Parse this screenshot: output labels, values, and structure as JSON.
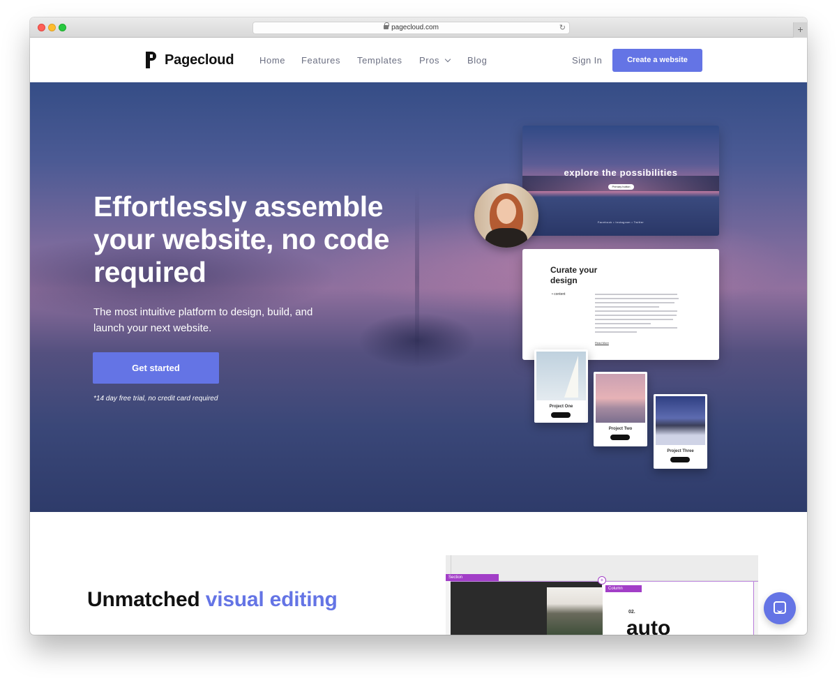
{
  "browser": {
    "url": "pagecloud.com",
    "new_tab_label": "+"
  },
  "nav": {
    "logo_text": "Pagecloud",
    "links": [
      "Home",
      "Features",
      "Templates",
      "Pros",
      "Blog"
    ],
    "sign_in": "Sign In",
    "cta": "Create a website"
  },
  "hero": {
    "title": "Effortlessly assemble your website, no code required",
    "subtitle": "The most intuitive platform to design, build, and launch your next website.",
    "button": "Get started",
    "note": "*14 day free trial, no credit card required"
  },
  "mockup": {
    "explore_title": "explore the possibilities",
    "explore_button": "Primary button",
    "explore_links": "Facebook  •  Instagram  •  Twitter",
    "curate_title": "Curate your design",
    "curate_bullet": "• content",
    "curate_more": "Read More",
    "projects": [
      "Project One",
      "Project Two",
      "Project Three"
    ]
  },
  "section2": {
    "title_plain": "Unmatched ",
    "title_accent": "visual editing",
    "editor_section_tag": "Section",
    "editor_column_tag": "Column",
    "editor_plus": "+",
    "editor_number": "02.",
    "editor_heading": "auto"
  },
  "colors": {
    "accent": "#6474e5",
    "editor_purple": "#a23ec7"
  }
}
